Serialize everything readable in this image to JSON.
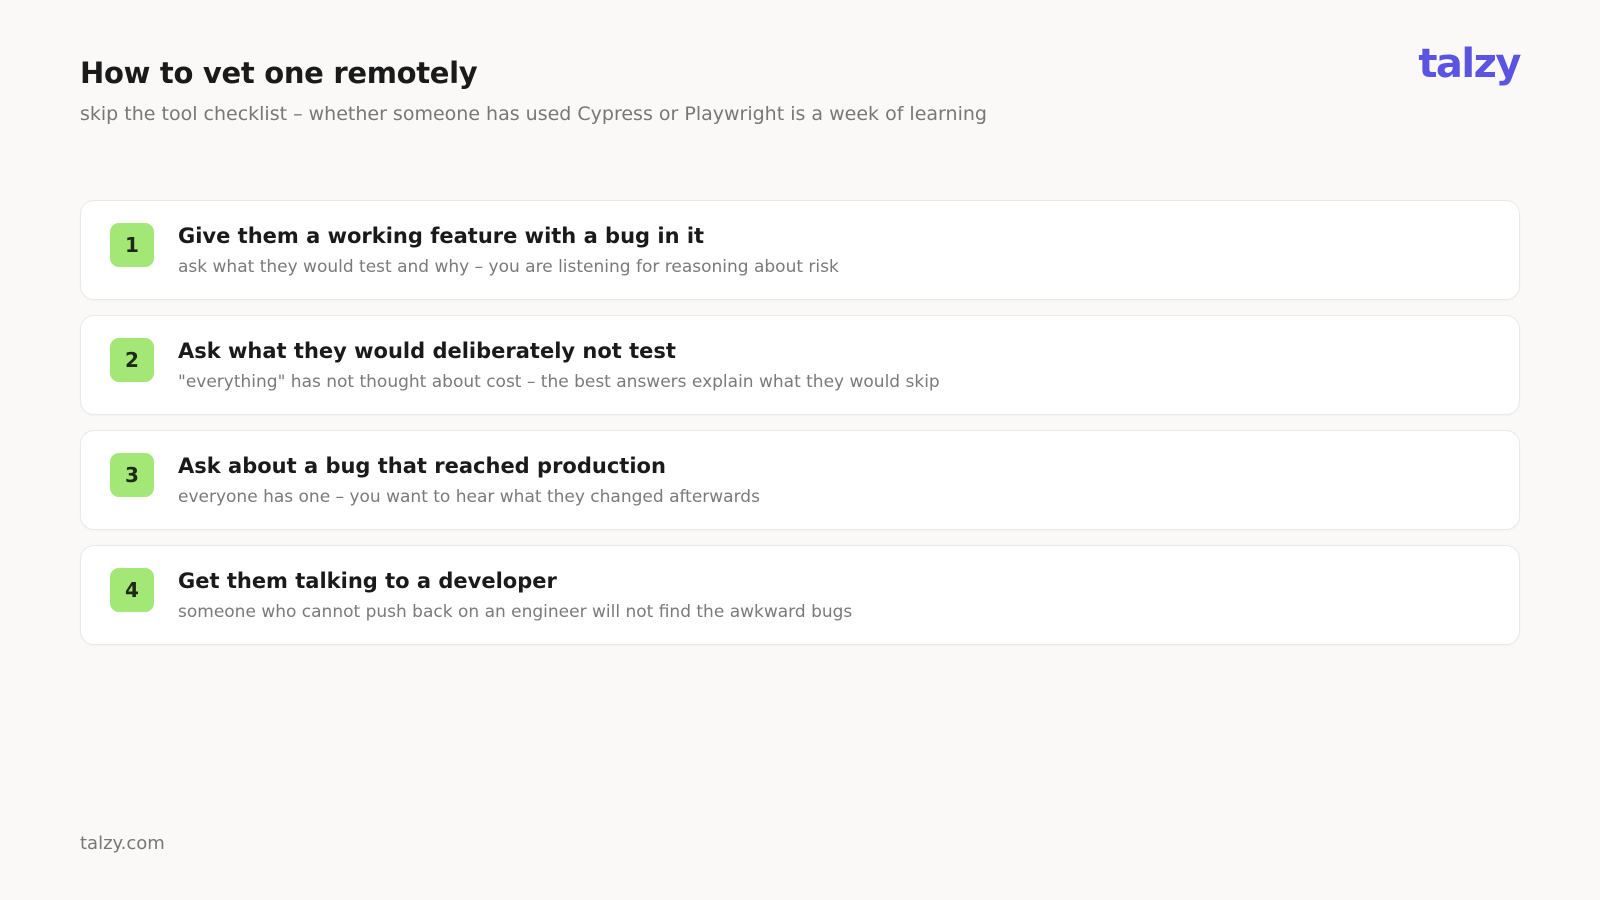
{
  "header": {
    "title": "How to vet one remotely",
    "subtitle": "skip the tool checklist – whether someone has used Cypress or Playwright is a week of learning",
    "logo_text": "talzy"
  },
  "steps": [
    {
      "number": "1",
      "title": "Give them a working feature with a bug in it",
      "description": "ask what they would test and why – you are listening for reasoning about risk"
    },
    {
      "number": "2",
      "title": "Ask what they would deliberately not test",
      "description": "\"everything\" has not thought about cost – the best answers explain what they would skip"
    },
    {
      "number": "3",
      "title": "Ask about a bug that reached production",
      "description": "everyone has one – you want to hear what they changed afterwards"
    },
    {
      "number": "4",
      "title": "Get them talking to a developer",
      "description": "someone who cannot push back on an engineer will not find the awkward bugs"
    }
  ],
  "footer": {
    "text": "talzy.com"
  },
  "colors": {
    "background": "#faf9f8",
    "brand": "#5b54e0",
    "badge": "#a3e877",
    "card": "#ffffff"
  }
}
